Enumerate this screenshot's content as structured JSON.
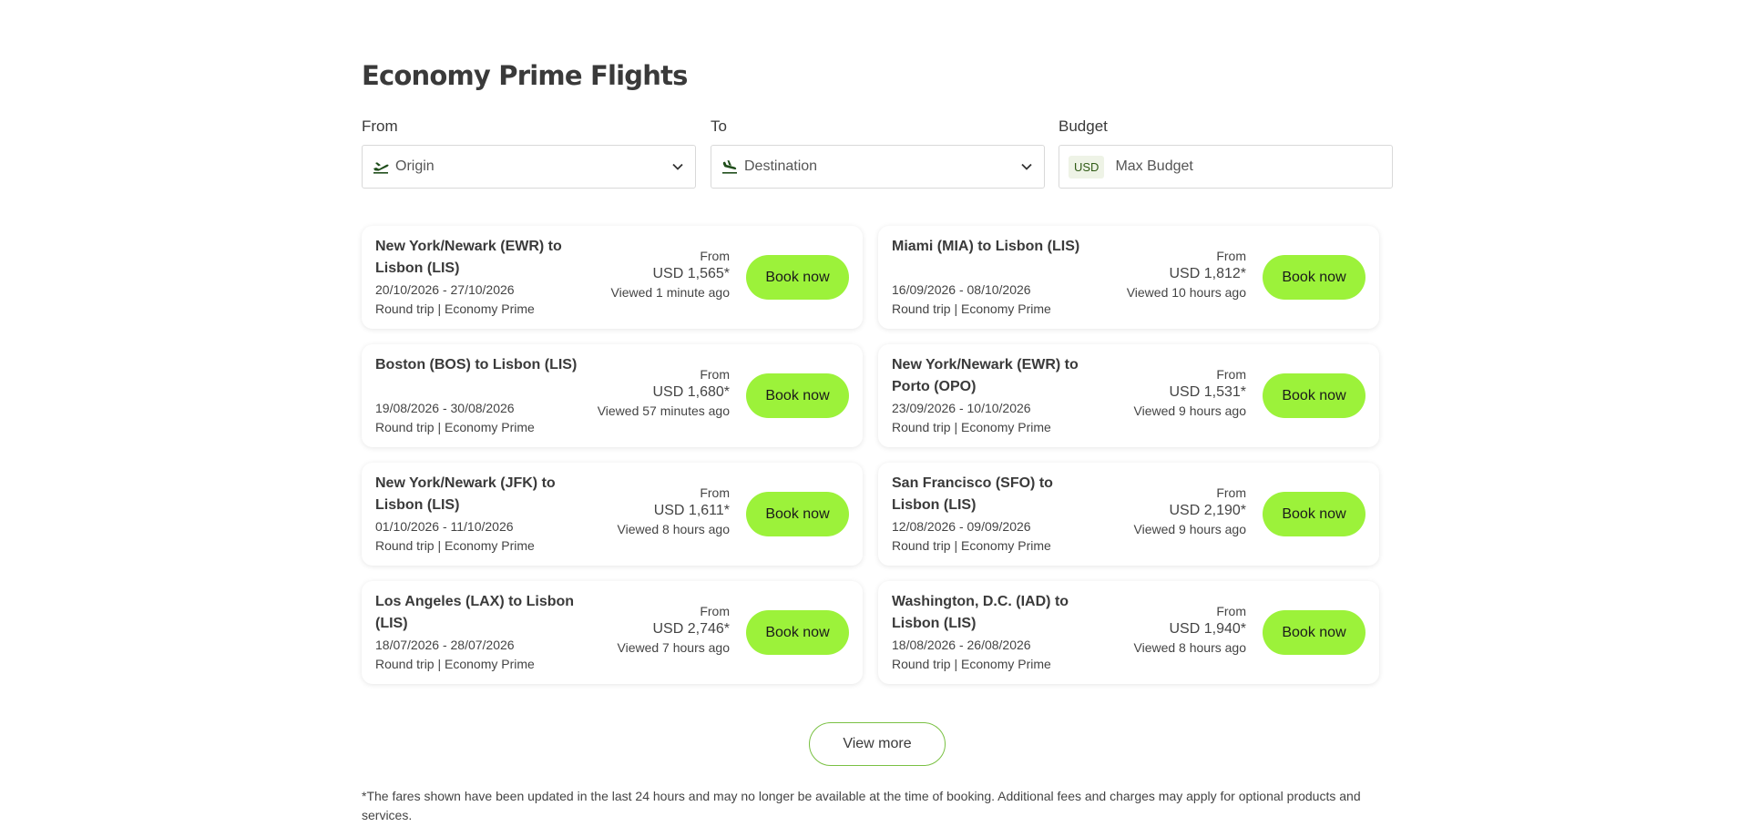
{
  "page": {
    "title": "Economy Prime Flights"
  },
  "filters": {
    "from": {
      "label": "From",
      "placeholder": "Origin"
    },
    "to": {
      "label": "To",
      "placeholder": "Destination"
    },
    "budget": {
      "label": "Budget",
      "currency": "USD",
      "placeholder": "Max Budget"
    }
  },
  "cards": [
    {
      "route": "New York/Newark (EWR) to Lisbon (LIS)",
      "dates": "20/10/2026 - 27/10/2026",
      "trip": "Round trip | Economy Prime",
      "from_label": "From",
      "price": "USD 1,565*",
      "viewed": "Viewed 1 minute ago",
      "button": "Book now"
    },
    {
      "route": "Miami (MIA) to Lisbon (LIS)",
      "dates": "16/09/2026 - 08/10/2026",
      "trip": "Round trip | Economy Prime",
      "from_label": "From",
      "price": "USD 1,812*",
      "viewed": "Viewed 10 hours ago",
      "button": "Book now"
    },
    {
      "route": "Boston (BOS) to Lisbon (LIS)",
      "dates": "19/08/2026 - 30/08/2026",
      "trip": "Round trip | Economy Prime",
      "from_label": "From",
      "price": "USD 1,680*",
      "viewed": "Viewed 57 minutes ago",
      "button": "Book now"
    },
    {
      "route": "New York/Newark (EWR) to Porto (OPO)",
      "dates": "23/09/2026 - 10/10/2026",
      "trip": "Round trip | Economy Prime",
      "from_label": "From",
      "price": "USD 1,531*",
      "viewed": "Viewed 9 hours ago",
      "button": "Book now"
    },
    {
      "route": "New York/Newark (JFK) to Lisbon (LIS)",
      "dates": "01/10/2026 - 11/10/2026",
      "trip": "Round trip | Economy Prime",
      "from_label": "From",
      "price": "USD 1,611*",
      "viewed": "Viewed 8 hours ago",
      "button": "Book now"
    },
    {
      "route": "San Francisco (SFO) to Lisbon (LIS)",
      "dates": "12/08/2026 - 09/09/2026",
      "trip": "Round trip | Economy Prime",
      "from_label": "From",
      "price": "USD 2,190*",
      "viewed": "Viewed 9 hours ago",
      "button": "Book now"
    },
    {
      "route": "Los Angeles (LAX) to Lisbon (LIS)",
      "dates": "18/07/2026 - 28/07/2026",
      "trip": "Round trip | Economy Prime",
      "from_label": "From",
      "price": "USD 2,746*",
      "viewed": "Viewed 7 hours ago",
      "button": "Book now"
    },
    {
      "route": "Washington, D.C. (IAD) to Lisbon (LIS)",
      "dates": "18/08/2026 - 26/08/2026",
      "trip": "Round trip | Economy Prime",
      "from_label": "From",
      "price": "USD 1,940*",
      "viewed": "Viewed 8 hours ago",
      "button": "Book now"
    }
  ],
  "view_more": "View more",
  "footnote": "*The fares shown have been updated in the last 24 hours and may no longer be available at the time of booking. Additional fees and charges may apply for optional products and services.",
  "colors": {
    "accent": "#9cf23a",
    "outline": "#7ac143",
    "plane_icon": "#1f4d1a"
  },
  "icons": {
    "origin": "plane-takeoff-icon",
    "destination": "plane-landing-icon",
    "dropdown": "chevron-down-icon"
  }
}
